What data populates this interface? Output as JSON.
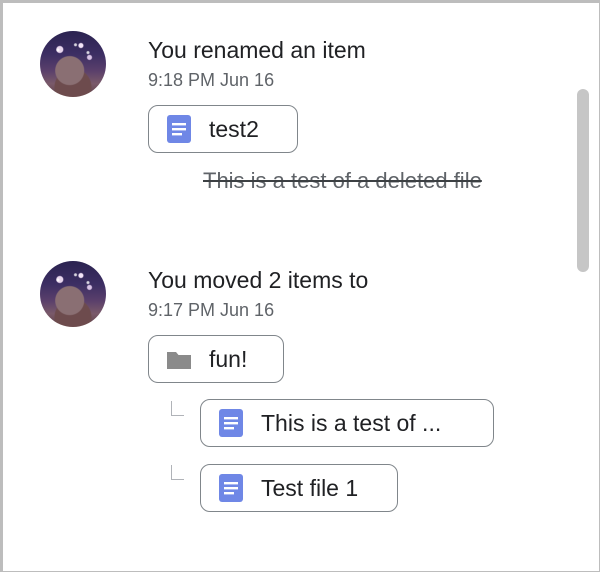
{
  "activities": [
    {
      "title": "You renamed an item",
      "time": "9:18 PM Jun 16",
      "item": {
        "name": "test2",
        "icon": "google-docs-icon"
      },
      "previous_name": "This is a test of a deleted file"
    },
    {
      "title": "You moved 2 items to",
      "time": "9:17 PM Jun 16",
      "destination": {
        "name": "fun!",
        "icon": "folder-icon"
      },
      "items": [
        {
          "name": "This is a test of ...",
          "icon": "google-docs-icon"
        },
        {
          "name": "Test file 1",
          "icon": "google-docs-icon"
        }
      ]
    }
  ],
  "colors": {
    "doc_icon": "#6f87e6",
    "folder_icon": "#8a8a8a",
    "chip_border": "#80868b",
    "scrollbar": "#c6c6c6"
  }
}
